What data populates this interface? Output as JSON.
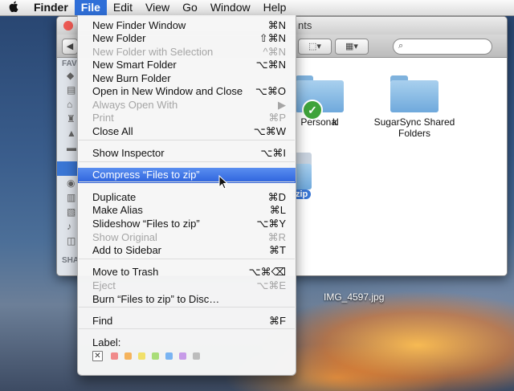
{
  "menubar": {
    "apple_icon": "apple-logo-icon",
    "items": [
      {
        "label": "Finder"
      },
      {
        "label": "File"
      },
      {
        "label": "Edit"
      },
      {
        "label": "View"
      },
      {
        "label": "Go"
      },
      {
        "label": "Window"
      },
      {
        "label": "Help"
      }
    ]
  },
  "finder_window": {
    "title_suffix": "nts",
    "sidebar_header_top": "FAV",
    "sidebar_header_bottom": "SHA",
    "folders": [
      {
        "label": "Personal"
      },
      {
        "label": "SugarSync Shared Folders"
      }
    ],
    "selected_item_label": "zip",
    "partial_label": "k"
  },
  "desktop_file": {
    "label": "IMG_4597.jpg"
  },
  "file_menu": {
    "items": [
      {
        "label": "New Finder Window",
        "shortcut": "⌘N",
        "disabled": false
      },
      {
        "label": "New Folder",
        "shortcut": "⇧⌘N",
        "disabled": false
      },
      {
        "label": "New Folder with Selection",
        "shortcut": "^⌘N",
        "disabled": true
      },
      {
        "label": "New Smart Folder",
        "shortcut": "⌥⌘N",
        "disabled": false
      },
      {
        "label": "New Burn Folder",
        "shortcut": "",
        "disabled": false
      },
      {
        "label": "Open in New Window and Close",
        "shortcut": "⌥⌘O",
        "disabled": false
      },
      {
        "label": "Always Open With",
        "shortcut": "▶",
        "disabled": true
      },
      {
        "label": "Print",
        "shortcut": "⌘P",
        "disabled": true
      },
      {
        "label": "Close All",
        "shortcut": "⌥⌘W",
        "disabled": false
      },
      {
        "label": "Show Inspector",
        "shortcut": "⌥⌘I",
        "disabled": false
      },
      {
        "label": "Compress “Files to zip”",
        "shortcut": "",
        "disabled": false,
        "highlighted": true
      },
      {
        "label": "Duplicate",
        "shortcut": "⌘D",
        "disabled": false
      },
      {
        "label": "Make Alias",
        "shortcut": "⌘L",
        "disabled": false
      },
      {
        "label": "Slideshow “Files to zip”",
        "shortcut": "⌥⌘Y",
        "disabled": false
      },
      {
        "label": "Show Original",
        "shortcut": "⌘R",
        "disabled": true
      },
      {
        "label": "Add to Sidebar",
        "shortcut": "⌘T",
        "disabled": false
      },
      {
        "label": "Move to Trash",
        "shortcut": "⌥⌘⌫",
        "disabled": false
      },
      {
        "label": "Eject",
        "shortcut": "⌥⌘E",
        "disabled": true
      },
      {
        "label": "Burn “Files to zip” to Disc…",
        "shortcut": "",
        "disabled": false
      },
      {
        "label": "Find",
        "shortcut": "⌘F",
        "disabled": false
      }
    ],
    "label_title": "Label:",
    "label_colors": [
      "#f08a8a",
      "#f5b35c",
      "#f1e06a",
      "#a9dd78",
      "#7ab4f2",
      "#c79be8",
      "#bdbdbd"
    ]
  }
}
